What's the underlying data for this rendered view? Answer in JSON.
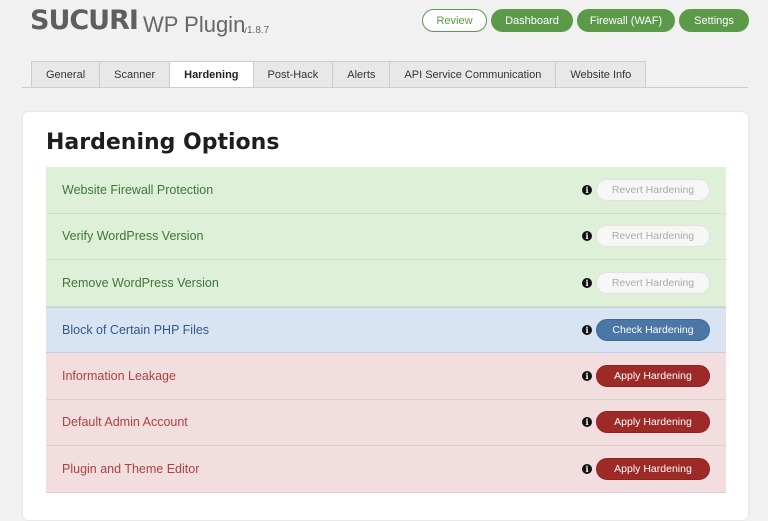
{
  "header": {
    "logo_text": "SUCURI",
    "product_name": "WP Plugin",
    "version": "v1.8.7",
    "buttons": [
      {
        "label": "Review",
        "style": "outline"
      },
      {
        "label": "Dashboard",
        "style": "solid"
      },
      {
        "label": "Firewall (WAF)",
        "style": "solid"
      },
      {
        "label": "Settings",
        "style": "solid"
      }
    ]
  },
  "tabs": [
    {
      "label": "General",
      "active": false
    },
    {
      "label": "Scanner",
      "active": false
    },
    {
      "label": "Hardening",
      "active": true
    },
    {
      "label": "Post-Hack",
      "active": false
    },
    {
      "label": "Alerts",
      "active": false
    },
    {
      "label": "API Service Communication",
      "active": false
    },
    {
      "label": "Website Info",
      "active": false
    }
  ],
  "card": {
    "title": "Hardening Options",
    "rows": [
      {
        "label": "Website Firewall Protection",
        "status": "applied",
        "button": "Revert Hardening"
      },
      {
        "label": "Verify WordPress Version",
        "status": "applied",
        "button": "Revert Hardening"
      },
      {
        "label": "Remove WordPress Version",
        "status": "applied",
        "button": "Revert Hardening"
      },
      {
        "label": "Block of Certain PHP Files",
        "status": "check",
        "button": "Check Hardening"
      },
      {
        "label": "Information Leakage",
        "status": "not-applied",
        "button": "Apply Hardening"
      },
      {
        "label": "Default Admin Account",
        "status": "not-applied",
        "button": "Apply Hardening"
      },
      {
        "label": "Plugin and Theme Editor",
        "status": "not-applied",
        "button": "Apply Hardening"
      }
    ]
  },
  "icons": {
    "info": "info-icon"
  },
  "colors": {
    "brand_green": "#5b9a49",
    "applied_bg": "#dff0d8",
    "check_bg": "#d9e4f2",
    "not_applied_bg": "#f2dede",
    "apply_button": "#9e2a28",
    "check_button": "#4a76a8"
  }
}
